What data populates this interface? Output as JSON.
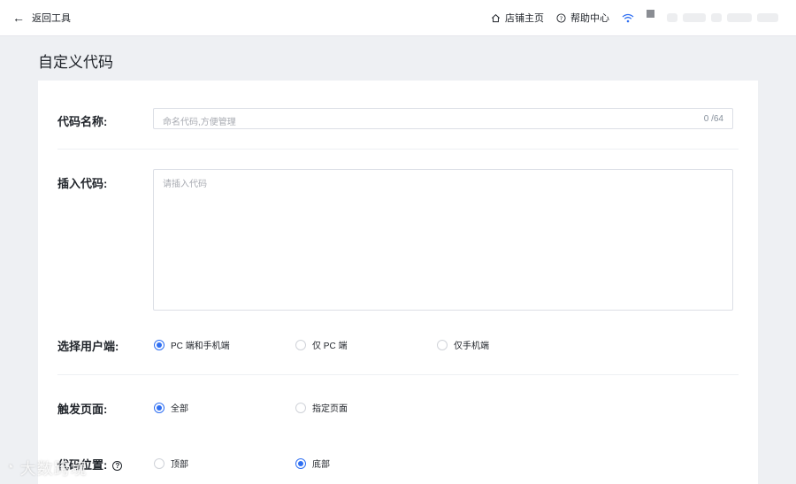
{
  "topbar": {
    "back_label": "返回工具",
    "store_home": "店铺主页",
    "help_center": "帮助中心"
  },
  "page": {
    "title": "自定义代码"
  },
  "form": {
    "name": {
      "label": "代码名称:",
      "placeholder": "命名代码,方便管理",
      "count": "0 /64"
    },
    "code": {
      "label": "插入代码:",
      "placeholder": "请插入代码"
    },
    "client": {
      "label": "选择用户端:",
      "options": [
        "PC 端和手机端",
        "仅 PC 端",
        "仅手机端"
      ],
      "selected": "PC 端和手机端"
    },
    "trigger": {
      "label": "触发页面:",
      "options": [
        "全部",
        "指定页面"
      ],
      "selected": "全部"
    },
    "position": {
      "label": "代码位置:",
      "options": [
        "顶部",
        "底部"
      ],
      "selected": "底部"
    }
  },
  "watermark": {
    "text": "大数跨境"
  },
  "colors": {
    "accent": "#2f6ff2",
    "background": "#eef0f3"
  }
}
